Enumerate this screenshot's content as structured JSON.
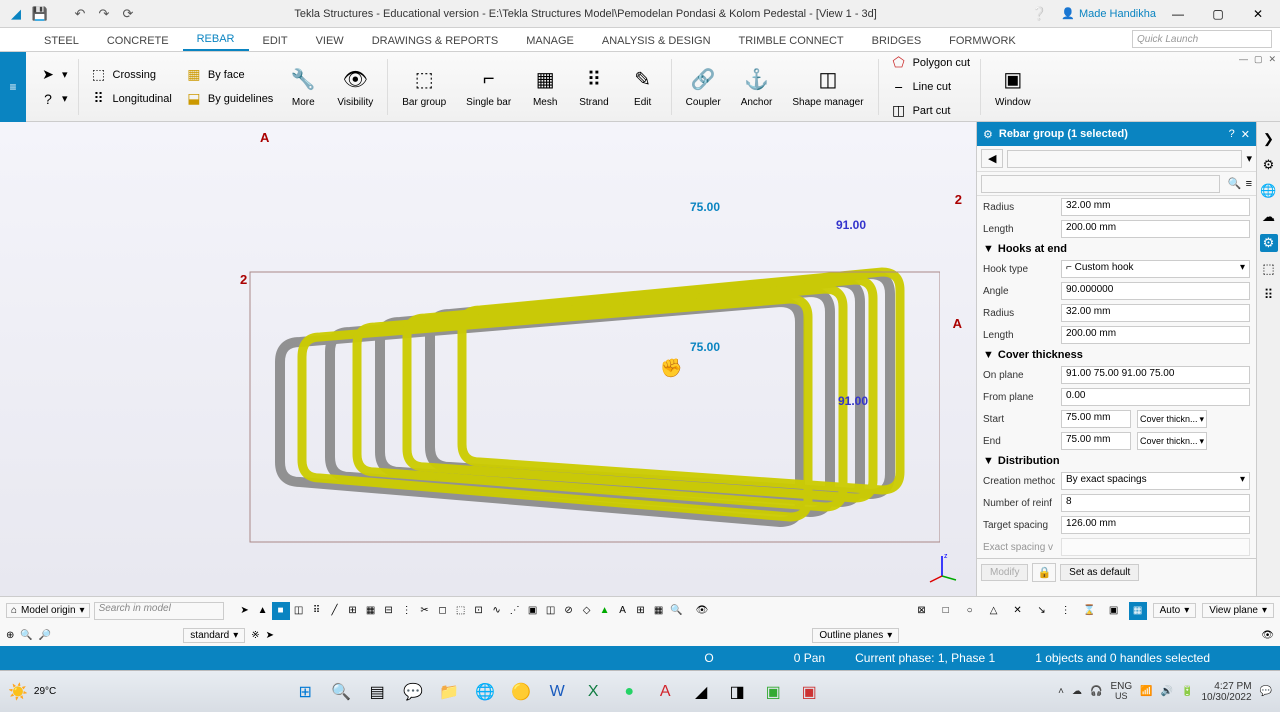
{
  "title": "Tekla Structures - Educational version - E:\\Tekla Structures Model\\Pemodelan Pondasi & Kolom Pedestal  - [View 1 - 3d]",
  "user": "Made Handikha",
  "quick_launch_placeholder": "Quick Launch",
  "tabs": [
    "STEEL",
    "CONCRETE",
    "REBAR",
    "EDIT",
    "VIEW",
    "DRAWINGS & REPORTS",
    "MANAGE",
    "ANALYSIS & DESIGN",
    "TRIMBLE CONNECT",
    "BRIDGES",
    "FORMWORK"
  ],
  "active_tab": 2,
  "ribbon": {
    "crossing": "Crossing",
    "longitudinal": "Longitudinal",
    "byface": "By face",
    "byguidelines": "By guidelines",
    "more": "More",
    "visibility": "Visibility",
    "bargroup": "Bar group",
    "singlebar": "Single bar",
    "mesh": "Mesh",
    "strand": "Strand",
    "edit": "Edit",
    "coupler": "Coupler",
    "anchor": "Anchor",
    "shapemgr": "Shape manager",
    "polygoncut": "Polygon cut",
    "linecut": "Line cut",
    "partcut": "Part cut",
    "window": "Window"
  },
  "panel": {
    "title": "Rebar group (1 selected)",
    "radius1": "32.00 mm",
    "length1": "200.00 mm",
    "sec_hooks": "Hooks at end",
    "hooktype_lbl": "Hook type",
    "hooktype_val": "Custom hook",
    "angle_lbl": "Angle",
    "angle_val": "90.000000",
    "radius2_lbl": "Radius",
    "radius2_val": "32.00 mm",
    "length2_lbl": "Length",
    "length2_val": "200.00 mm",
    "sec_cover": "Cover thickness",
    "onplane_lbl": "On plane",
    "onplane_val": "91.00 75.00 91.00 75.00",
    "fromplane_lbl": "From plane",
    "fromplane_val": "0.00",
    "start_lbl": "Start",
    "start_val": "75.00 mm",
    "start_dd": "Cover thickn...",
    "end_lbl": "End",
    "end_val": "75.00 mm",
    "end_dd": "Cover thickn...",
    "sec_dist": "Distribution",
    "creation_lbl": "Creation method",
    "creation_val": "By exact spacings",
    "numreinf_lbl": "Number of reinf",
    "numreinf_val": "8",
    "targetsp_lbl": "Target spacing",
    "targetsp_val": "126.00 mm",
    "exactsp_lbl": "Exact spacing v",
    "modify": "Modify",
    "setdefault": "Set as default",
    "radius_lbl": "Radius",
    "length_lbl": "Length"
  },
  "viewport": {
    "dim75_1": "75.00",
    "dim91_1": "91.00",
    "dim75_2": "75.00",
    "dim91_2": "91.00",
    "A": "A",
    "two": "2"
  },
  "bottom": {
    "model_origin": "Model origin",
    "search_ph": "Search in model",
    "standard": "standard",
    "auto": "Auto",
    "viewplane": "View plane",
    "outline": "Outline planes"
  },
  "status": {
    "coord": "O",
    "pan": "0  Pan",
    "phase": "Current phase: 1, Phase 1",
    "sel": "1 objects and 0 handles selected"
  },
  "taskbar": {
    "temp": "29°C",
    "lang": "ENG",
    "locale": "US",
    "time": "4:27 PM",
    "date": "10/30/2022"
  }
}
